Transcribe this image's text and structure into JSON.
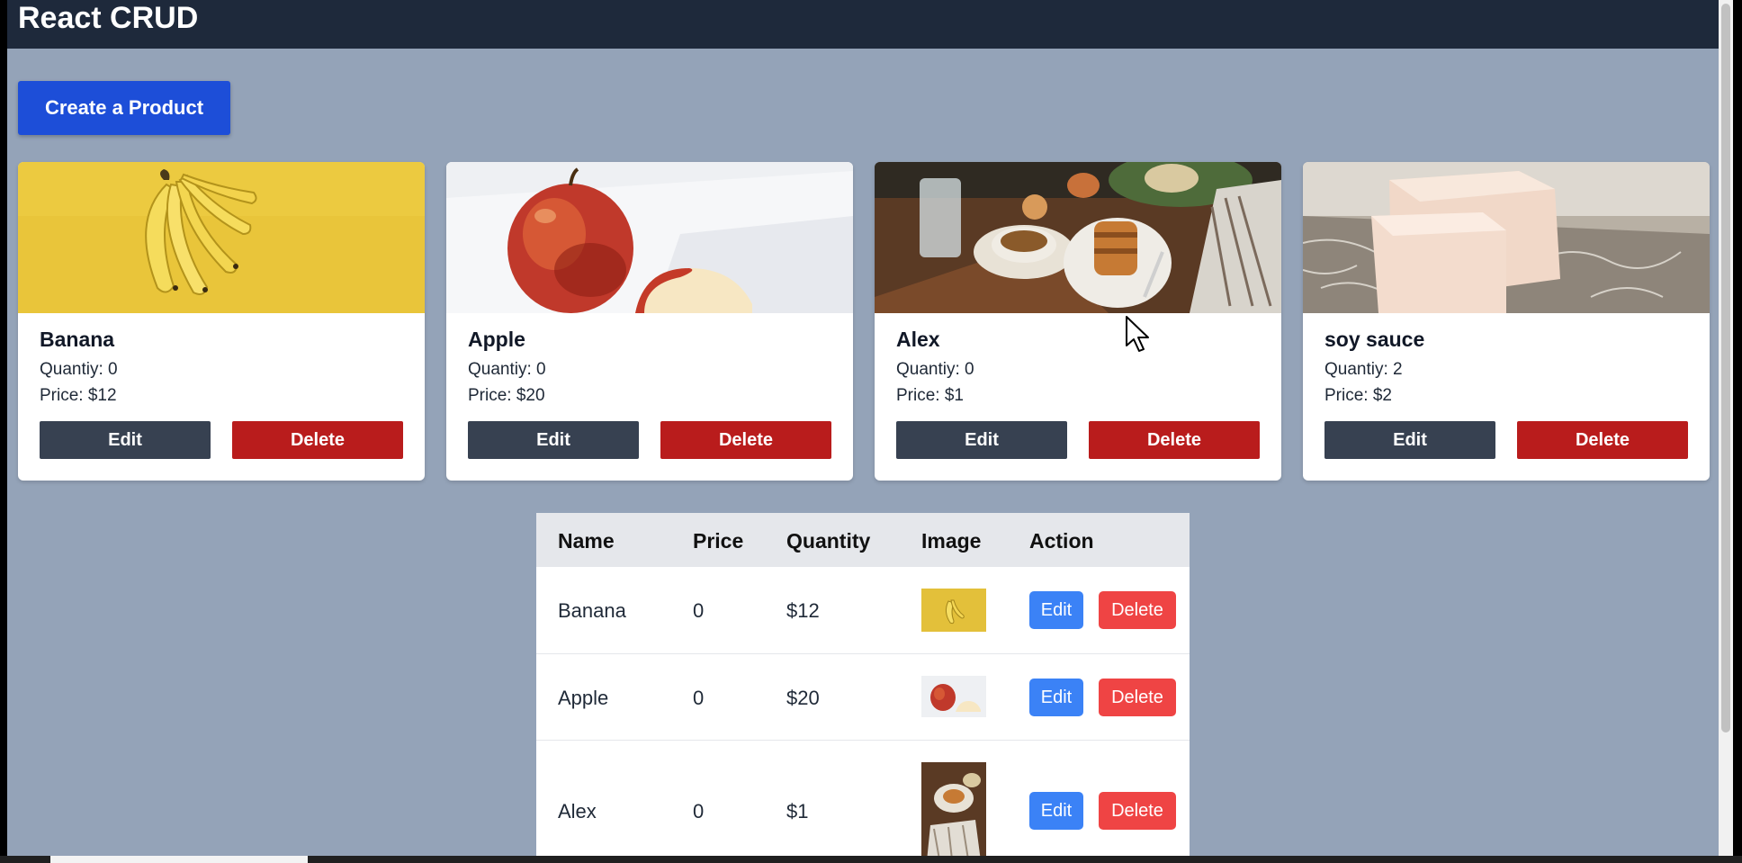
{
  "app": {
    "title": "React CRUD"
  },
  "actions": {
    "create_label": "Create a Product"
  },
  "cards": [
    {
      "name": "Banana",
      "quantity_text": "Quantiy: 0",
      "price_text": "Price: $12",
      "edit_label": "Edit",
      "delete_label": "Delete",
      "image": "banana-photo"
    },
    {
      "name": "Apple",
      "quantity_text": "Quantiy: 0",
      "price_text": "Price: $20",
      "edit_label": "Edit",
      "delete_label": "Delete",
      "image": "apple-photo"
    },
    {
      "name": "Alex",
      "quantity_text": "Quantiy: 0",
      "price_text": "Price: $1",
      "edit_label": "Edit",
      "delete_label": "Delete",
      "image": "breakfast-photo"
    },
    {
      "name": "soy sauce",
      "quantity_text": "Quantiy: 2",
      "price_text": "Price: $2",
      "edit_label": "Edit",
      "delete_label": "Delete",
      "image": "soap-photo"
    }
  ],
  "table": {
    "headers": [
      "Name",
      "Price",
      "Quantity",
      "Image",
      "Action"
    ],
    "rows": [
      {
        "name": "Banana",
        "price": "0",
        "quantity": "$12",
        "image": "banana-photo",
        "edit_label": "Edit",
        "delete_label": "Delete"
      },
      {
        "name": "Apple",
        "price": "0",
        "quantity": "$20",
        "image": "apple-photo",
        "edit_label": "Edit",
        "delete_label": "Delete"
      },
      {
        "name": "Alex",
        "price": "0",
        "quantity": "$1",
        "image": "breakfast-photo",
        "edit_label": "Edit",
        "delete_label": "Delete"
      }
    ]
  },
  "colors": {
    "navbar": "#1e293b",
    "page_bg": "#94a3b8",
    "primary": "#1d4ed8",
    "card_edit": "#374151",
    "card_delete": "#b91c1c",
    "table_edit": "#3b82f6",
    "table_delete": "#ef4444"
  }
}
